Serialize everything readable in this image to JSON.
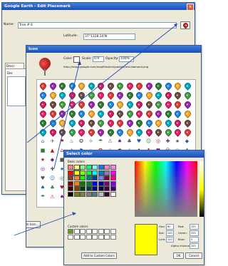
{
  "placemark": {
    "title": "Google Earth - Edit Placemark",
    "name_label": "Name:",
    "name_value": "Tree # 6",
    "latitude_label": "Latitude:",
    "latitude_value": "37°1328.24'N",
    "tab_label": "Descr",
    "tab_sublabel": "Des",
    "add_custom_icon_button": "Add Custom Icon..."
  },
  "icon": {
    "title": "Icon",
    "color_label": "Color:",
    "scale_label": "Scale:",
    "scale_value": "0.9",
    "opacity_label": "Opacity:",
    "opacity_value": "100%",
    "url": "http://maps.google.com/mapfiles/kml/paddle/red-diamond.png"
  },
  "select_color": {
    "title": "Select color",
    "basic_colors_label": "Basic colors",
    "custom_colors_label": "Custom colors",
    "add_custom_colors_button": "Add to Custom Colors",
    "hue_label": "Hue:",
    "hue_value": "60",
    "sat_label": "Sat:",
    "sat_value": "240",
    "lum_label": "Lum:",
    "lum_value": "120",
    "red_label": "Red:",
    "red_value": "255",
    "green_label": "Green:",
    "green_value": "255",
    "blue_label": "Blue:",
    "blue_value": "0",
    "alpha_label": "Alpha channel:",
    "alpha_value": "255",
    "ok_button": "OK",
    "cancel_button": "Cancel",
    "current_color": "#ffff00"
  },
  "colors": {
    "pin_palette": [
      "#e53935",
      "#9c27b0",
      "#2e7d32",
      "#1e88e5",
      "#f9a825",
      "#00acc1",
      "#d81b60",
      "#6d4c41",
      "#43a047",
      "#e91e63"
    ],
    "basic_colors": [
      "#ff8080",
      "#ffff80",
      "#80ff80",
      "#00ff80",
      "#80ffff",
      "#0080ff",
      "#ff80c0",
      "#ff80ff",
      "#ff0000",
      "#ffff00",
      "#80ff00",
      "#00ff40",
      "#00ffff",
      "#0080c0",
      "#8080c0",
      "#ff00ff",
      "#804040",
      "#ff8040",
      "#00ff00",
      "#008080",
      "#004080",
      "#8080ff",
      "#800040",
      "#ff0080",
      "#800000",
      "#ff8000",
      "#008000",
      "#008040",
      "#0000ff",
      "#0000a0",
      "#800080",
      "#8000ff",
      "#400000",
      "#804000",
      "#004000",
      "#004040",
      "#000080",
      "#000040",
      "#400040",
      "#400080",
      "#000000",
      "#808000",
      "#808040",
      "#808080",
      "#408080",
      "#c0c0c0",
      "#400040",
      "#ffffff"
    ]
  }
}
